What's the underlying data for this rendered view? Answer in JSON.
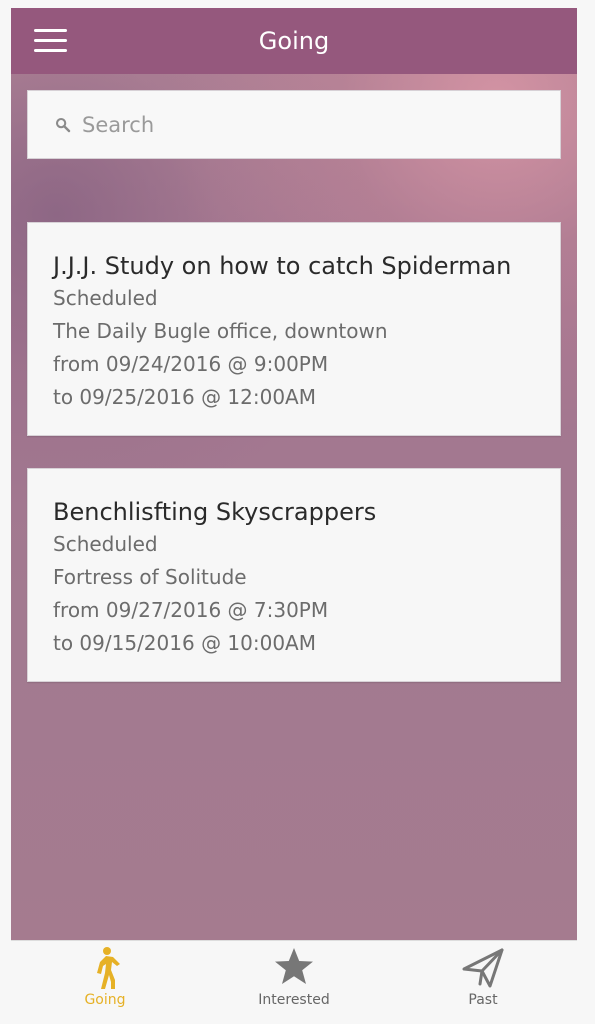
{
  "header": {
    "title": "Going"
  },
  "search": {
    "placeholder": "Search",
    "value": ""
  },
  "events": [
    {
      "title": "J.J.J. Study on how to catch Spiderman",
      "status": "Scheduled",
      "location": "The Daily Bugle office, downtown",
      "from": "from 09/24/2016 @ 9:00PM",
      "to": "to 09/25/2016 @ 12:00AM"
    },
    {
      "title": "Benchlisfting Skyscrappers",
      "status": "Scheduled",
      "location": "Fortress of Solitude",
      "from": "from 09/27/2016 @ 7:30PM",
      "to": "to 09/15/2016 @ 10:00AM"
    }
  ],
  "tabs": [
    {
      "label": "Going",
      "icon": "walking-person-icon",
      "active": true
    },
    {
      "label": "Interested",
      "icon": "star-icon",
      "active": false
    },
    {
      "label": "Past",
      "icon": "paper-plane-icon",
      "active": false
    }
  ],
  "colors": {
    "header": "#95587d",
    "background": "#a6788f",
    "card": "#f7f7f7",
    "active_tab": "#e6b126",
    "inactive_tab": "#666666"
  }
}
